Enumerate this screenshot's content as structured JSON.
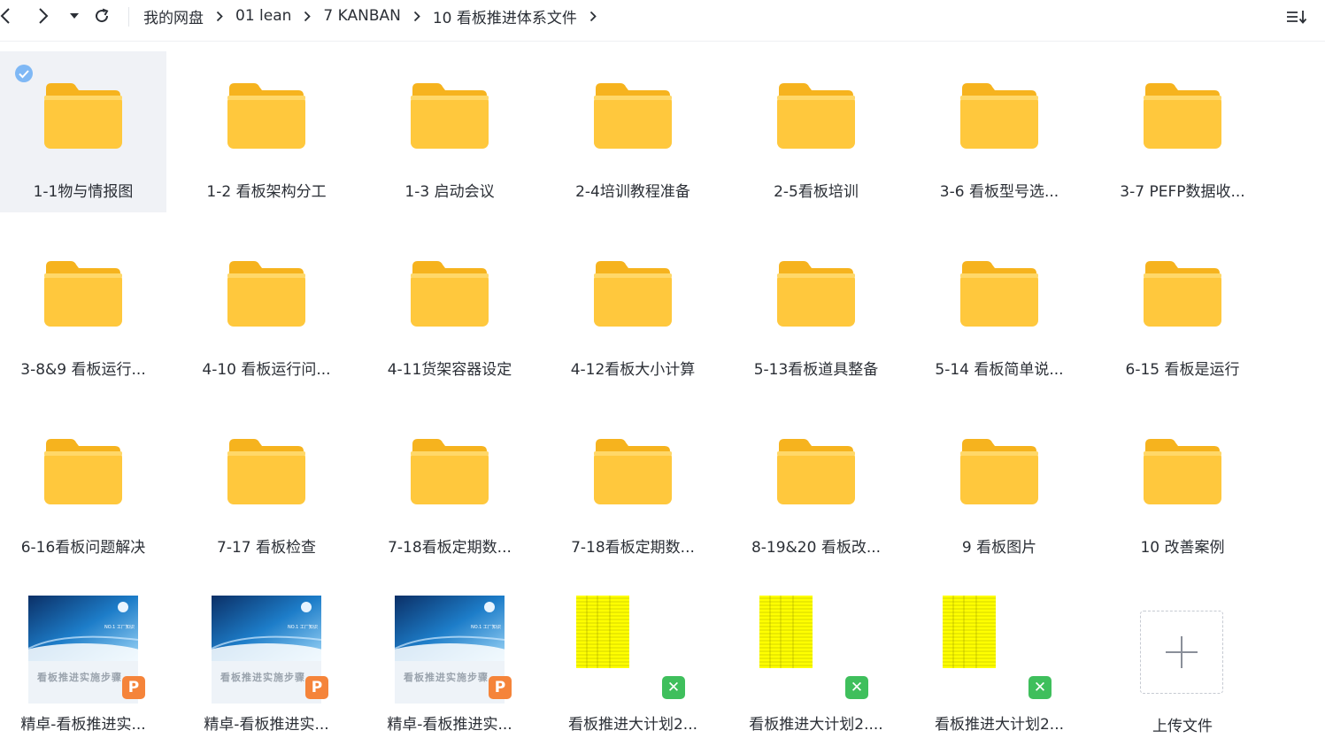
{
  "breadcrumb": [
    "我的网盘",
    "01 lean",
    "7 KANBAN",
    "10 看板推进体系文件"
  ],
  "folders": [
    "1-1物与情报图",
    "1-2 看板架构分工",
    "1-3 启动会议",
    "2-4培训教程准备",
    "2-5看板培训",
    "3-6 看板型号选...",
    "3-7 PEFP数据收...",
    "3-8&9 看板运行...",
    "4-10 看板运行问...",
    "4-11货架容器设定",
    "4-12看板大小计算",
    "5-13看板道具整备",
    "5-14 看板简单说...",
    "6-15 看板是运行",
    "6-16看板问题解决",
    "7-17 看板检查",
    "7-18看板定期数...",
    "7-18看板定期数...",
    "8-19&20 看板改...",
    "9 看板图片",
    "10 改善案例"
  ],
  "files": [
    {
      "name": "精卓-看板推进实...",
      "type": "ppt",
      "badge": "P",
      "thumb_title": "看板推进实施步骤",
      "thumb_sub": "NO.1 工厂知识"
    },
    {
      "name": "精卓-看板推进实...",
      "type": "ppt",
      "badge": "P",
      "thumb_title": "看板推进实施步骤",
      "thumb_sub": "NO.1 工厂知识"
    },
    {
      "name": "精卓-看板推进实...",
      "type": "ppt",
      "badge": "P",
      "thumb_title": "看板推进实施步骤",
      "thumb_sub": "NO.1 工厂知识"
    },
    {
      "name": "看板推进大计划2...",
      "type": "excel",
      "badge": "✕"
    },
    {
      "name": "看板推进大计划2....",
      "type": "excel",
      "badge": "✕"
    },
    {
      "name": "看板推进大计划2...",
      "type": "excel",
      "badge": "✕"
    }
  ],
  "upload_label": "上传文件",
  "icons": {
    "back": "chevron-left-icon",
    "forward": "chevron-right-icon",
    "history": "dropdown-caret-icon",
    "refresh": "refresh-icon",
    "sort": "sort-list-icon",
    "selected": "check-circle-icon",
    "upload": "plus-icon"
  },
  "colors": {
    "folder": "#FFC83D",
    "folder_dark": "#F6B31E",
    "selected_bg": "#f0f2f6",
    "check": "#7fb8f5",
    "ppt_badge": "#F5843A",
    "excel_badge": "#3FBF5C",
    "sheet_yellow": "#FFFF00"
  }
}
